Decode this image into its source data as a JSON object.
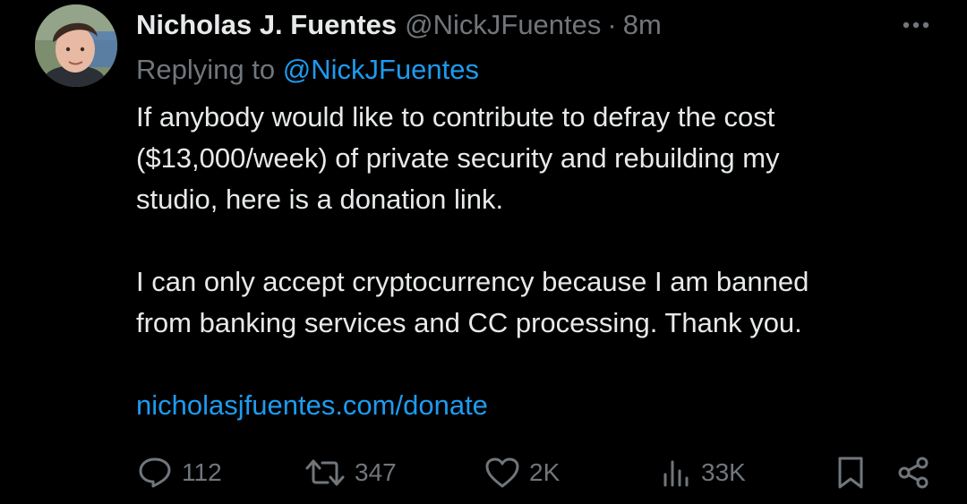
{
  "tweet": {
    "display_name": "Nicholas J. Fuentes",
    "handle": "@NickJFuentes",
    "separator": "·",
    "time": "8m",
    "replying_prefix": "Replying to",
    "replying_handle": "@NickJFuentes",
    "body_lines_1": [
      "If anybody would like to contribute to defray the cost",
      "($13,000/week) of private security and rebuilding my",
      "studio, here is a donation link."
    ],
    "body_lines_2": [
      "I can only accept cryptocurrency because I am banned",
      "from banking services and CC processing. Thank you."
    ],
    "link_text": "nicholasjfuentes.com/donate"
  },
  "actions": {
    "replies": "112",
    "reposts": "347",
    "likes": "2K",
    "views": "33K"
  },
  "icons": {
    "more": "more-horizontal-icon",
    "reply": "reply-bubble-icon",
    "repost": "repost-arrows-icon",
    "like": "heart-icon",
    "views": "views-bar-chart-icon",
    "bookmark": "bookmark-icon",
    "share": "share-icon"
  },
  "colors": {
    "background": "#000000",
    "primary_text": "#e7e9ea",
    "secondary_text": "#71767b",
    "accent": "#1d9bf0"
  }
}
